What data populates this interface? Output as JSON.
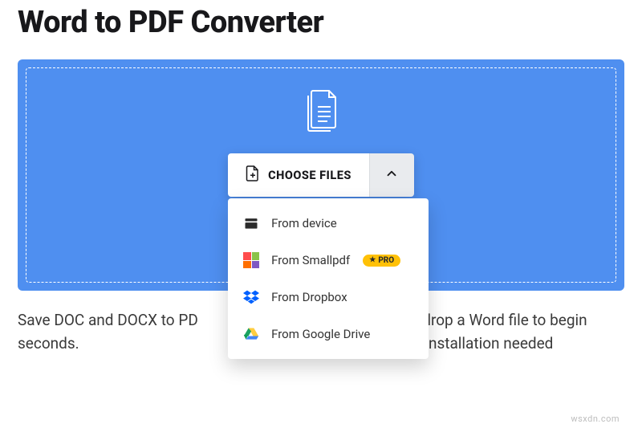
{
  "title": "Word to PDF Converter",
  "choose_label": "CHOOSE FILES",
  "sources": {
    "device": "From device",
    "smallpdf": "From Smallpdf",
    "dropbox": "From Dropbox",
    "gdrive": "From Google Drive"
  },
  "pro_badge": "PRO",
  "description_line1_left": "Save DOC and DOCX to PD",
  "description_line1_right": "drop a Word file to begin",
  "description_line2_left": "seconds.",
  "description_line2_right": "ation or installation needed",
  "watermark": "wsxdn.com"
}
